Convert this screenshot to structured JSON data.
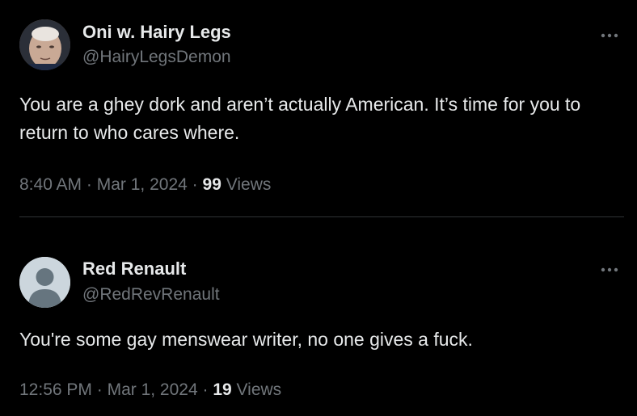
{
  "tweets": [
    {
      "display_name": "Oni w. Hairy Legs",
      "handle": "@HairyLegsDemon",
      "text": "You are a ghey dork and aren’t actually American. It’s time for you to return to who cares where.",
      "time": "8:40 AM",
      "date": "Mar 1, 2024",
      "views_count": "99",
      "views_label": "Views",
      "avatar": "photo-avatar"
    },
    {
      "display_name": "Red Renault",
      "handle": "@RedRevRenault",
      "text": "You're some gay menswear writer, no one gives a fuck.",
      "time": "12:56 PM",
      "date": "Mar 1, 2024",
      "views_count": "19",
      "views_label": "Views",
      "avatar": "default-avatar"
    }
  ],
  "separator": "·",
  "more_icon": "more-horizontal-icon",
  "colors": {
    "background": "#000000",
    "primary_text": "#e7e9ea",
    "secondary_text": "#71767b",
    "divider": "#2f3336",
    "default_avatar": "#ccd6dd"
  }
}
